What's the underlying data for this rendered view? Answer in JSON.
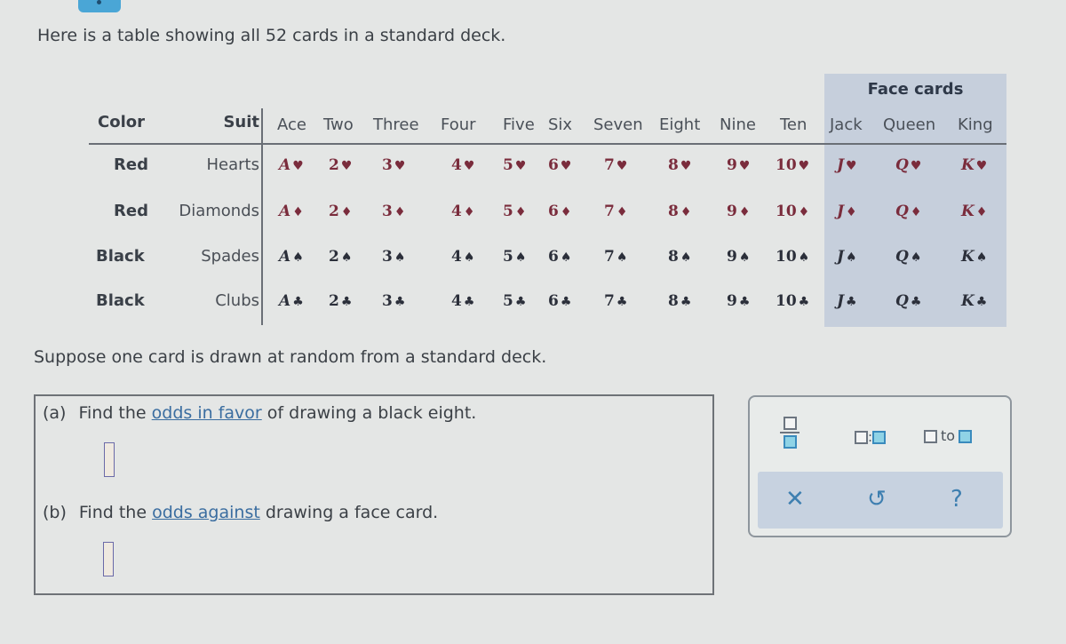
{
  "intro_text": "Here is a table showing all 52 cards in a standard deck.",
  "table": {
    "face_cards_label": "Face cards",
    "color_header": "Color",
    "suit_header": "Suit",
    "columns": [
      "Ace",
      "Two",
      "Three",
      "Four",
      "Five",
      "Six",
      "Seven",
      "Eight",
      "Nine",
      "Ten",
      "Jack",
      "Queen",
      "King"
    ],
    "rows": [
      {
        "color": "Red",
        "suit": "Hearts",
        "symbol": "♥",
        "tone": "red",
        "cards": [
          "A",
          "2",
          "3",
          "4",
          "5",
          "6",
          "7",
          "8",
          "9",
          "10",
          "J",
          "Q",
          "K"
        ]
      },
      {
        "color": "Red",
        "suit": "Diamonds",
        "symbol": "♦",
        "tone": "red",
        "cards": [
          "A",
          "2",
          "3",
          "4",
          "5",
          "6",
          "7",
          "8",
          "9",
          "10",
          "J",
          "Q",
          "K"
        ]
      },
      {
        "color": "Black",
        "suit": "Spades",
        "symbol": "♠",
        "tone": "black",
        "cards": [
          "A",
          "2",
          "3",
          "4",
          "5",
          "6",
          "7",
          "8",
          "9",
          "10",
          "J",
          "Q",
          "K"
        ]
      },
      {
        "color": "Black",
        "suit": "Clubs",
        "symbol": "♣",
        "tone": "black",
        "cards": [
          "A",
          "2",
          "3",
          "4",
          "5",
          "6",
          "7",
          "8",
          "9",
          "10",
          "J",
          "Q",
          "K"
        ]
      }
    ]
  },
  "prompt_text": "Suppose one card is drawn at random from a standard deck.",
  "questions": [
    {
      "label": "(a)",
      "pre": "Find the ",
      "link": "odds in favor",
      "post": " of drawing a black eight.",
      "answer": ""
    },
    {
      "label": "(b)",
      "pre": "Find the ",
      "link": "odds against",
      "post": " drawing a face card.",
      "answer": ""
    }
  ],
  "toolbar": {
    "fraction_icon": "fraction-template-icon",
    "ratio_separator": ":",
    "to_word": "to",
    "clear_symbol": "✕",
    "undo_symbol": "↺",
    "help_symbol": "?"
  },
  "colors": {
    "red_card": "#7a2c3c",
    "black_card": "#2b2f3a",
    "face_highlight": "#c6cfdc",
    "accent": "#3e7fb0"
  }
}
